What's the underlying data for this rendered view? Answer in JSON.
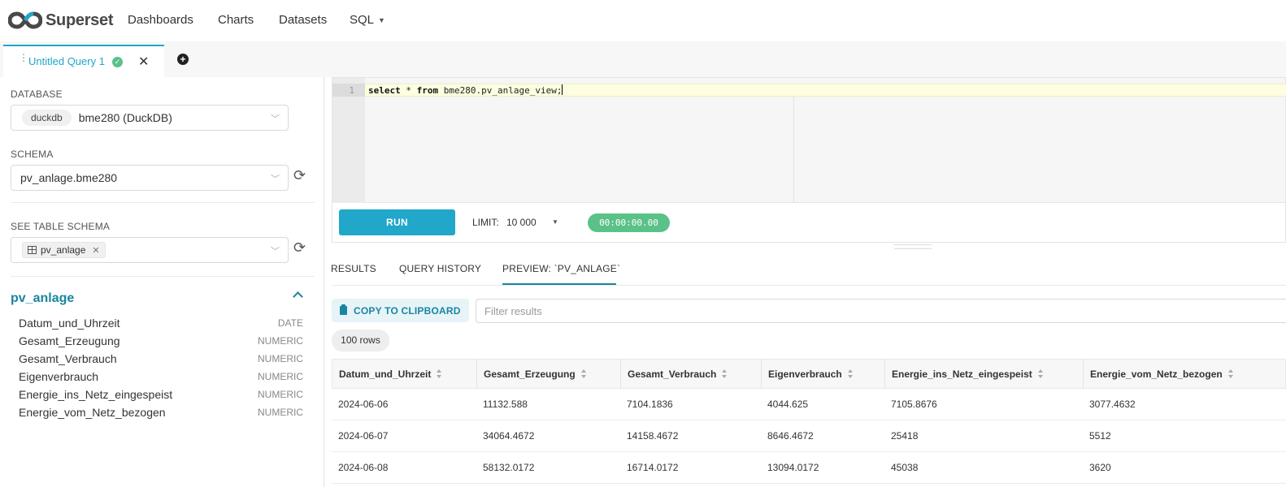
{
  "app": {
    "brand": "Superset",
    "nav": {
      "dashboards": "Dashboards",
      "charts": "Charts",
      "datasets": "Datasets",
      "sql": "SQL"
    }
  },
  "query_tab": {
    "title": "Untitled Query 1",
    "status_icon": "check-circle-icon",
    "close_icon": "close-icon",
    "add_icon": "plus-circle-icon"
  },
  "left_panel": {
    "database_label": "DATABASE",
    "database_tag": "duckdb",
    "database_name": "bme280 (DuckDB)",
    "schema_label": "SCHEMA",
    "schema_value": "pv_anlage.bme280",
    "table_schema_label": "SEE TABLE SCHEMA",
    "selected_table": "pv_anlage",
    "table_title": "pv_anlage",
    "columns": [
      {
        "name": "Datum_und_Uhrzeit",
        "type": "DATE"
      },
      {
        "name": "Gesamt_Erzeugung",
        "type": "NUMERIC"
      },
      {
        "name": "Gesamt_Verbrauch",
        "type": "NUMERIC"
      },
      {
        "name": "Eigenverbrauch",
        "type": "NUMERIC"
      },
      {
        "name": "Energie_ins_Netz_eingespeist",
        "type": "NUMERIC"
      },
      {
        "name": "Energie_vom_Netz_bezogen",
        "type": "NUMERIC"
      }
    ]
  },
  "editor": {
    "line_number": "1",
    "kw_select": "select",
    "star": " * ",
    "kw_from": "from",
    "rest": " bme280.pv_anlage_view;"
  },
  "run_bar": {
    "run_label": "RUN",
    "limit_label": "LIMIT:",
    "limit_value": "10 000",
    "timer": "00:00:00.00"
  },
  "results": {
    "tabs": [
      "RESULTS",
      "QUERY HISTORY",
      "PREVIEW: `PV_ANLAGE`"
    ],
    "copy_label": "COPY TO CLIPBOARD",
    "filter_placeholder": "Filter results",
    "row_count": "100 rows",
    "columns": [
      "Datum_und_Uhrzeit",
      "Gesamt_Erzeugung",
      "Gesamt_Verbrauch",
      "Eigenverbrauch",
      "Energie_ins_Netz_eingespeist",
      "Energie_vom_Netz_bezogen"
    ],
    "rows": [
      [
        "2024-06-06",
        "11132.588",
        "7104.1836",
        "4044.625",
        "7105.8676",
        "3077.4632"
      ],
      [
        "2024-06-07",
        "34064.4672",
        "14158.4672",
        "8646.4672",
        "25418",
        "5512"
      ],
      [
        "2024-06-08",
        "58132.0172",
        "16714.0172",
        "13094.0172",
        "45038",
        "3620"
      ]
    ]
  },
  "colors": {
    "accent": "#20a7c9",
    "accent_dark": "#1a85a0",
    "success": "#5ac189"
  }
}
